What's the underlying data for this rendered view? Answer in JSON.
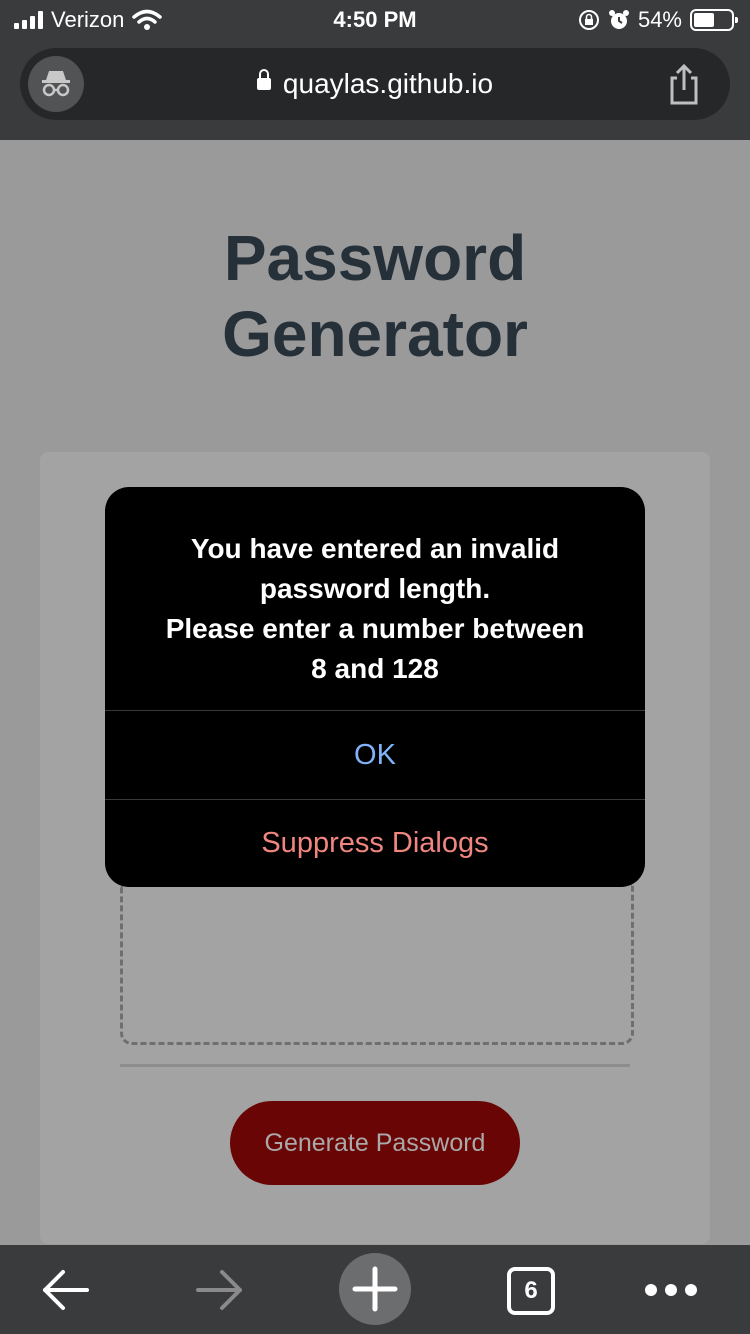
{
  "status_bar": {
    "carrier": "Verizon",
    "time": "4:50 PM",
    "battery_percent": "54%",
    "battery_level": 0.54
  },
  "browser": {
    "url": "quaylas.github.io",
    "tab_count": "6"
  },
  "page": {
    "title_line1": "Password",
    "title_line2": "Generator",
    "generate_button_label": "Generate Password",
    "button_color": "#6a0505"
  },
  "alert": {
    "message_lines": [
      "You have entered an invalid",
      "password length.",
      "Please enter a number between",
      "8 and 128"
    ],
    "ok_label": "OK",
    "suppress_label": "Suppress Dialogs",
    "ok_color": "#7fb2f8",
    "suppress_color": "#f08680"
  },
  "icons": {
    "incognito": "incognito-icon",
    "lock": "lock-icon",
    "share": "share-icon",
    "back": "back-arrow-icon",
    "forward": "forward-arrow-icon",
    "new_tab": "plus-icon",
    "more": "more-dots-icon"
  }
}
